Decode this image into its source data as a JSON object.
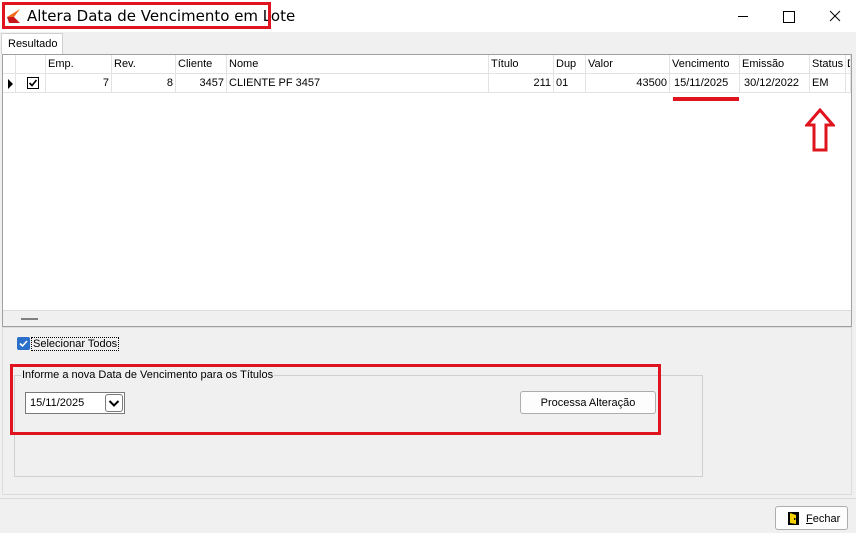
{
  "window": {
    "title": "Altera Data de Vencimento em Lote",
    "controls": {
      "minimize": "minimize-icon",
      "maximize": "maximize-icon",
      "close": "close-icon"
    }
  },
  "tabs": [
    {
      "label": "Resultado"
    }
  ],
  "grid": {
    "columns": [
      "Emp.",
      "Rev.",
      "Cliente",
      "Nome",
      "Título",
      "Dup",
      "Valor",
      "Vencimento",
      "Emissão",
      "Status",
      "D"
    ],
    "rows": [
      {
        "selected": true,
        "checked": true,
        "cells": [
          "7",
          "8",
          "3457",
          "CLIENTE PF 3457",
          "211",
          "01",
          "43500",
          "15/11/2025",
          "30/12/2022",
          "EM"
        ]
      }
    ]
  },
  "select_all": {
    "label": "Selecionar Todos",
    "checked": true
  },
  "date_group": {
    "caption": "Informe a nova Data de Vencimento para os Títulos",
    "date_value": "15/11/2025",
    "process_label": "Processa Alteração"
  },
  "footer": {
    "close_label": "Fechar"
  },
  "colors": {
    "highlight": "#e0141e",
    "accent": "#2a6fc9"
  }
}
